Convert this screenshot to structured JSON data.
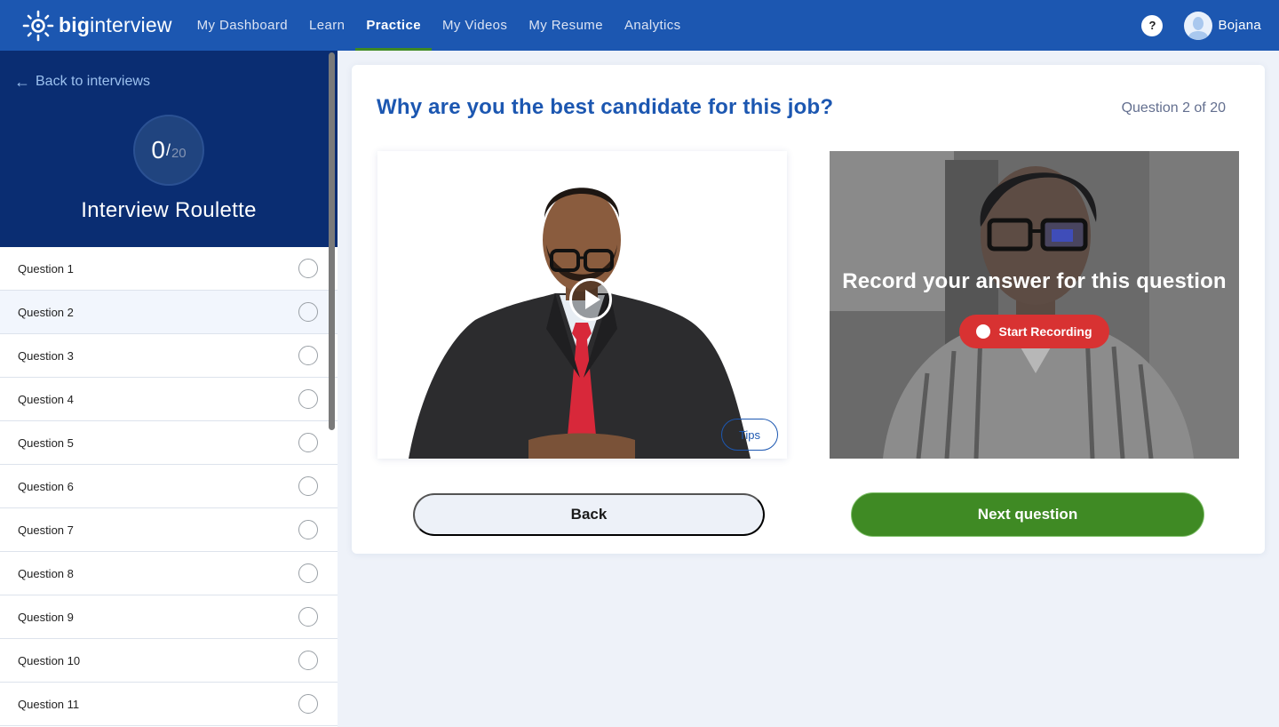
{
  "brand": {
    "logo_icon": "sun-icon",
    "name_bold": "big",
    "name_light": "interview"
  },
  "nav": {
    "items": [
      {
        "label": "My Dashboard",
        "active": false
      },
      {
        "label": "Learn",
        "active": false
      },
      {
        "label": "Practice",
        "active": true
      },
      {
        "label": "My Videos",
        "active": false
      },
      {
        "label": "My Resume",
        "active": false
      },
      {
        "label": "Analytics",
        "active": false
      }
    ],
    "active_color": "#3f8a24"
  },
  "user": {
    "help_label": "?",
    "name": "Bojana"
  },
  "sidebar": {
    "back_label": "Back to interviews",
    "progress": {
      "completed": "0",
      "separator": "/",
      "total": "20"
    },
    "title": "Interview Roulette",
    "questions": [
      {
        "label": "Question 1",
        "completed": false,
        "current": false
      },
      {
        "label": "Question 2",
        "completed": false,
        "current": true
      },
      {
        "label": "Question 3",
        "completed": false,
        "current": false
      },
      {
        "label": "Question 4",
        "completed": false,
        "current": false
      },
      {
        "label": "Question 5",
        "completed": false,
        "current": false
      },
      {
        "label": "Question 6",
        "completed": false,
        "current": false
      },
      {
        "label": "Question 7",
        "completed": false,
        "current": false
      },
      {
        "label": "Question 8",
        "completed": false,
        "current": false
      },
      {
        "label": "Question 9",
        "completed": false,
        "current": false
      },
      {
        "label": "Question 10",
        "completed": false,
        "current": false
      },
      {
        "label": "Question 11",
        "completed": false,
        "current": false
      }
    ]
  },
  "main": {
    "question_text": "Why are you the best candidate for this job?",
    "question_counter": "Question 2 of 20",
    "interviewer_video": {
      "play_icon": "play-icon",
      "tips_label": "Tips"
    },
    "recorder": {
      "prompt": "Record your answer for this question",
      "start_label": "Start Recording",
      "record_color": "#d83232"
    },
    "back_label": "Back",
    "next_label": "Next question",
    "next_color": "#3f8a24"
  },
  "colors": {
    "topbar": "#1c57b1",
    "sidebar_header": "#0a2d72",
    "accent_blue": "#1c57b1"
  }
}
